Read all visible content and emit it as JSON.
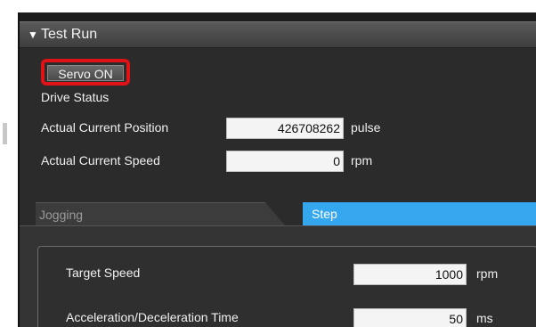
{
  "panel": {
    "title": "Test Run"
  },
  "servo_button": {
    "label": "Servo ON"
  },
  "drive_status": {
    "heading": "Drive Status",
    "actual_position": {
      "label": "Actual Current Position",
      "value": "426708262",
      "unit": "pulse"
    },
    "actual_speed": {
      "label": "Actual Current Speed",
      "value": "0",
      "unit": "rpm"
    }
  },
  "tabs": [
    {
      "label": "Jogging",
      "selected": false
    },
    {
      "label": "Step",
      "selected": true
    }
  ],
  "step_settings": {
    "target_speed": {
      "label": "Target Speed",
      "value": "1000",
      "unit": "rpm"
    },
    "accel_decel_time": {
      "label": "Acceleration/Deceleration Time",
      "value": "50",
      "unit": "ms"
    }
  },
  "colors": {
    "highlight_ring": "#e01218",
    "selected_tab": "#35a7ee",
    "panel_bg": "#2b2b2b"
  },
  "icons": {
    "collapse": "caret-down-icon"
  }
}
